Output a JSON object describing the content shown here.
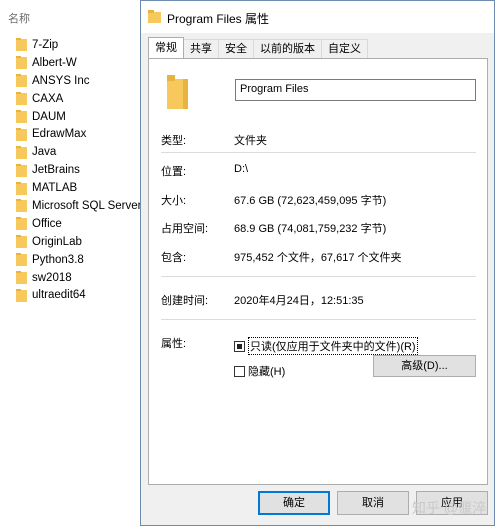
{
  "explorer": {
    "column_header": "名称",
    "items": [
      "7-Zip",
      "Albert-W",
      "ANSYS Inc",
      "CAXA",
      "DAUM",
      "EdrawMax",
      "Java",
      "JetBrains",
      "MATLAB",
      "Microsoft SQL Server",
      "Office",
      "OriginLab",
      "Python3.8",
      "sw2018",
      "ultraedit64"
    ]
  },
  "dialog": {
    "title": "Program Files 属性",
    "tabs": [
      "常规",
      "共享",
      "安全",
      "以前的版本",
      "自定义"
    ],
    "active_tab": 0,
    "name_value": "Program Files",
    "props": [
      {
        "label": "类型:",
        "value": "文件夹"
      },
      {
        "label": "位置:",
        "value": "D:\\"
      },
      {
        "label": "大小:",
        "value": "67.6 GB (72,623,459,095 字节)"
      },
      {
        "label": "占用空间:",
        "value": "68.9 GB (74,081,759,232 字节)"
      },
      {
        "label": "包含:",
        "value": "975,452 个文件，67,617 个文件夹"
      }
    ],
    "created": {
      "label": "创建时间:",
      "value": "2020年4月24日，12:51:35"
    },
    "attributes": {
      "label": "属性:",
      "readonly_label": "只读(仅应用于文件夹中的文件)(R)",
      "hidden_label": "隐藏(H)",
      "advanced_button": "高级(D)..."
    },
    "buttons": {
      "ok": "确定",
      "cancel": "取消",
      "apply": "应用"
    }
  },
  "watermark": "知乎 @偃淬",
  "colors": {
    "folder": "#f7c95c",
    "accent": "#0078d7"
  }
}
